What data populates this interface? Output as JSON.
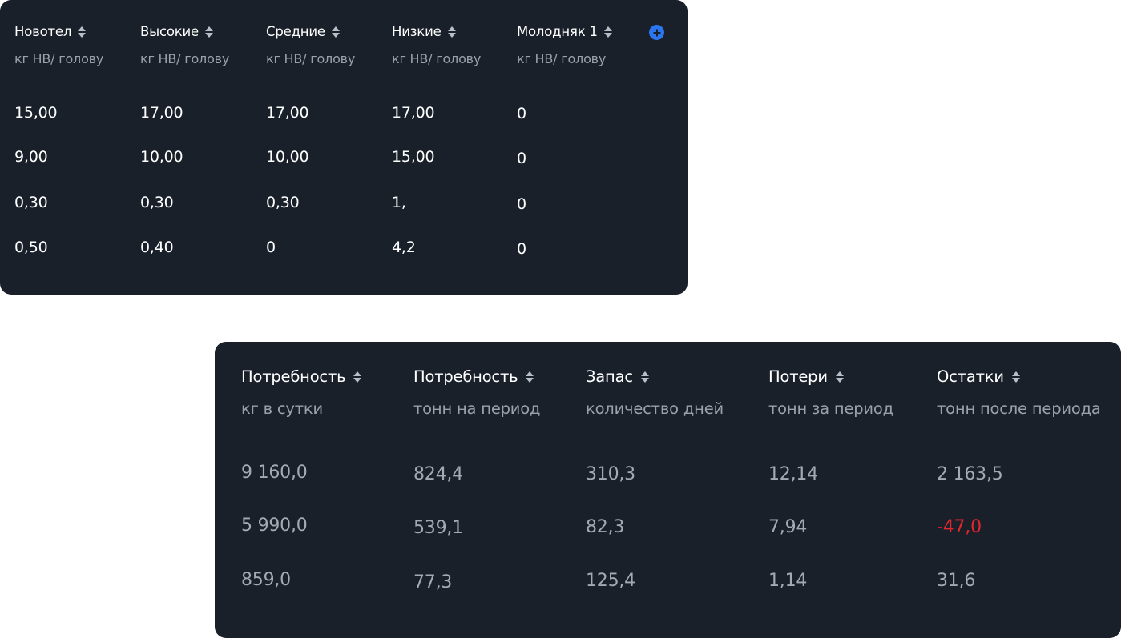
{
  "colors": {
    "panel_bg": "#19202a",
    "header_text": "#ffffff",
    "sub_text": "#9aa1ab",
    "cell_text_top": "#ffffff",
    "cell_text_bottom": "#a4aab3",
    "negative": "#e3262b",
    "accent": "#2b76ee"
  },
  "top_table": {
    "add_icon": "plus-circle-icon",
    "sort_icon": "sort-arrows-icon",
    "columns": [
      {
        "label": "Новотел",
        "unit": "кг НВ/ голову"
      },
      {
        "label": "Высокие",
        "unit": "кг НВ/ голову"
      },
      {
        "label": "Средние",
        "unit": "кг НВ/ голову"
      },
      {
        "label": "Низкие",
        "unit": "кг НВ/ голову"
      },
      {
        "label": "Молодняк 1",
        "unit": "кг НВ/ голову"
      }
    ],
    "rows": [
      [
        "15,00",
        "17,00",
        "17,00",
        "17,00",
        "0"
      ],
      [
        "9,00",
        "10,00",
        "10,00",
        "15,00",
        "0"
      ],
      [
        "0,30",
        "0,30",
        "0,30",
        "1,",
        "0"
      ],
      [
        "0,50",
        "0,40",
        "0",
        "4,2",
        "0"
      ]
    ]
  },
  "bottom_table": {
    "sort_icon": "sort-arrows-icon",
    "columns": [
      {
        "label": "Потребность",
        "unit": "кг в сутки"
      },
      {
        "label": "Потребность",
        "unit": "тонн на период"
      },
      {
        "label": "Запас",
        "unit": "количество дней"
      },
      {
        "label": "Потери",
        "unit": "тонн за период"
      },
      {
        "label": "Остатки",
        "unit": "тонн после периода"
      }
    ],
    "rows": [
      [
        "9 160,0",
        "824,4",
        "310,3",
        "12,14",
        "2 163,5"
      ],
      [
        "5 990,0",
        "539,1",
        "82,3",
        "7,94",
        "-47,0"
      ],
      [
        "859,0",
        "77,3",
        "125,4",
        "1,14",
        "31,6"
      ]
    ]
  }
}
